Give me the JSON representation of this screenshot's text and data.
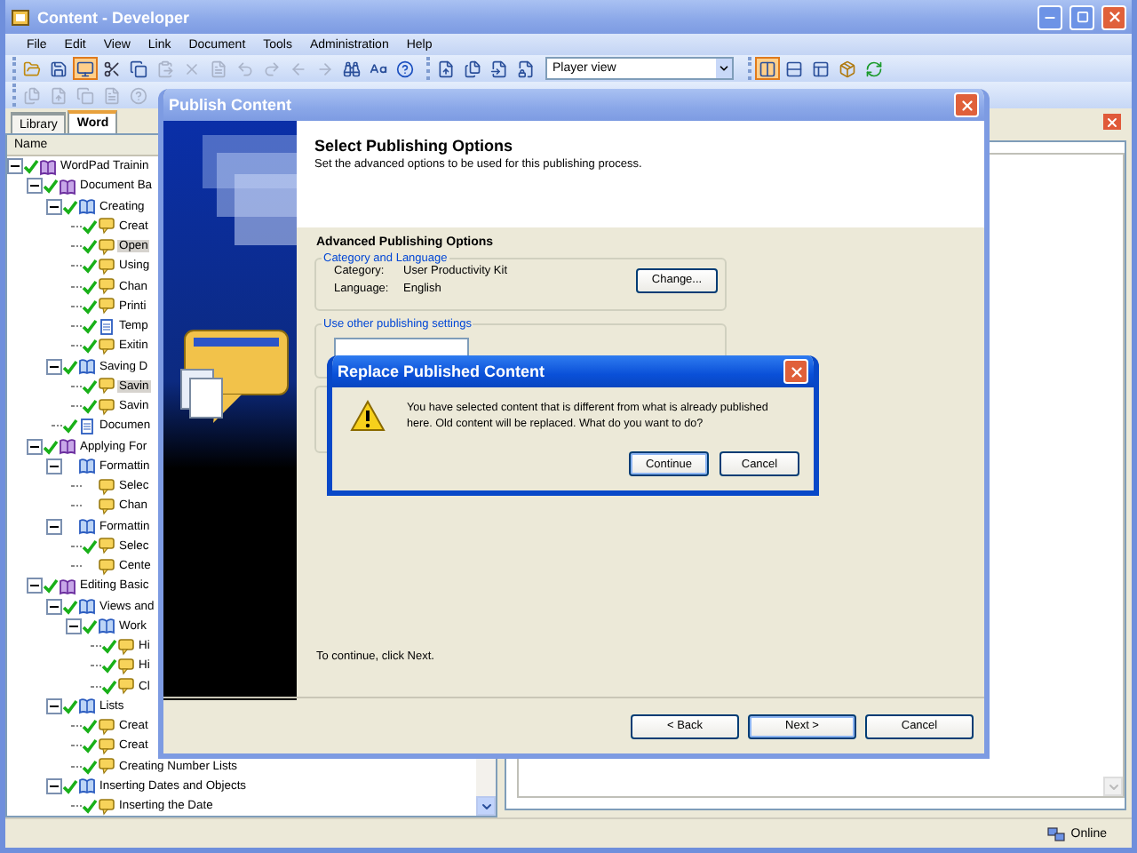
{
  "window": {
    "title": "Content - Developer",
    "active": false
  },
  "menu": [
    "File",
    "Edit",
    "View",
    "Link",
    "Document",
    "Tools",
    "Administration",
    "Help"
  ],
  "toolbar": {
    "groups": [
      {
        "items": [
          {
            "kind": "folder",
            "disabled": false,
            "selected": false
          },
          {
            "kind": "disk",
            "disabled": false,
            "selected": false
          },
          {
            "kind": "monitor",
            "disabled": false,
            "selected": true
          },
          {
            "kind": "scissors",
            "disabled": false,
            "selected": false
          },
          {
            "kind": "copy",
            "disabled": false,
            "selected": false
          },
          {
            "kind": "clipboard",
            "disabled": true,
            "selected": false
          },
          {
            "kind": "cross",
            "disabled": true,
            "selected": false
          },
          {
            "kind": "document",
            "disabled": true,
            "selected": false
          },
          {
            "kind": "undo",
            "disabled": true,
            "selected": false
          },
          {
            "kind": "redo",
            "disabled": true,
            "selected": false
          },
          {
            "kind": "arrowleft",
            "disabled": true,
            "selected": false
          },
          {
            "kind": "arrowright",
            "disabled": true,
            "selected": false
          },
          {
            "kind": "binoculars",
            "disabled": false,
            "selected": false
          },
          {
            "kind": "letters",
            "disabled": false,
            "selected": false
          },
          {
            "kind": "help",
            "disabled": false,
            "selected": false
          }
        ]
      },
      {
        "items": [
          {
            "kind": "upload",
            "disabled": false,
            "selected": false
          },
          {
            "kind": "files",
            "disabled": false,
            "selected": false
          },
          {
            "kind": "import",
            "disabled": false,
            "selected": false
          },
          {
            "kind": "lock",
            "disabled": false,
            "selected": false
          },
          {
            "kind": "select",
            "value": "Player view"
          }
        ]
      },
      {
        "items": [
          {
            "kind": "columns",
            "disabled": false,
            "selected": true
          },
          {
            "kind": "rows",
            "disabled": false,
            "selected": false
          },
          {
            "kind": "panels",
            "disabled": false,
            "selected": false
          },
          {
            "kind": "package",
            "disabled": false,
            "selected": false
          },
          {
            "kind": "refresh",
            "disabled": false,
            "selected": false
          }
        ]
      }
    ]
  },
  "toolbar_2": [
    {
      "kind": "files",
      "disabled": true
    },
    {
      "kind": "upload",
      "disabled": true
    },
    {
      "kind": "copy",
      "disabled": true
    },
    {
      "kind": "document",
      "disabled": true
    },
    {
      "kind": "help",
      "disabled": true
    }
  ],
  "tabs": [
    {
      "label": "Library",
      "selected": false
    },
    {
      "label": "Word",
      "selected": true
    }
  ],
  "tree": {
    "column": "Name",
    "items": [
      {
        "label": "WordPad Trainin",
        "kind": "module",
        "checked": true,
        "selected": false,
        "expanded": true,
        "children": [
          {
            "label": "Document Ba",
            "kind": "module",
            "checked": true,
            "selected": false,
            "expanded": true,
            "children": [
              {
                "label": "Creating",
                "kind": "section",
                "checked": true,
                "selected": false,
                "expanded": true,
                "children": [
                  {
                    "label": "Creat",
                    "kind": "topic",
                    "checked": true,
                    "selected": false
                  },
                  {
                    "label": "Open",
                    "kind": "topic",
                    "checked": true,
                    "selected": true
                  },
                  {
                    "label": "Using",
                    "kind": "topic",
                    "checked": true,
                    "selected": false
                  },
                  {
                    "label": "Chan",
                    "kind": "topic",
                    "checked": true,
                    "selected": false
                  },
                  {
                    "label": "Printi",
                    "kind": "topic",
                    "checked": true,
                    "selected": false
                  },
                  {
                    "label": "Temp",
                    "kind": "document",
                    "checked": true,
                    "selected": false
                  },
                  {
                    "label": "Exitin",
                    "kind": "topic",
                    "checked": true,
                    "selected": false
                  }
                ]
              },
              {
                "label": "Saving D",
                "kind": "section",
                "checked": true,
                "selected": false,
                "expanded": true,
                "children": [
                  {
                    "label": "Savin",
                    "kind": "topic",
                    "checked": true,
                    "selected": true
                  },
                  {
                    "label": "Savin",
                    "kind": "topic",
                    "checked": true,
                    "selected": false
                  }
                ]
              },
              {
                "label": "Documen",
                "kind": "document",
                "checked": true,
                "selected": false
              }
            ]
          },
          {
            "label": "Applying For",
            "kind": "module",
            "checked": true,
            "selected": false,
            "expanded": true,
            "children": [
              {
                "label": "Formattin",
                "kind": "section",
                "checked": false,
                "selected": false,
                "expanded": true,
                "children": [
                  {
                    "label": "Selec",
                    "kind": "topic",
                    "checked": false,
                    "selected": false
                  },
                  {
                    "label": "Chan",
                    "kind": "topic",
                    "checked": false,
                    "selected": false
                  }
                ]
              },
              {
                "label": "Formattin",
                "kind": "section",
                "checked": false,
                "selected": false,
                "expanded": true,
                "children": [
                  {
                    "label": "Selec",
                    "kind": "topic",
                    "checked": true,
                    "selected": false
                  },
                  {
                    "label": "Cente",
                    "kind": "topic",
                    "checked": false,
                    "selected": false
                  }
                ]
              }
            ]
          },
          {
            "label": "Editing Basic",
            "kind": "module",
            "checked": true,
            "selected": false,
            "expanded": true,
            "children": [
              {
                "label": "Views and",
                "kind": "section",
                "checked": true,
                "selected": false,
                "expanded": true,
                "children": [
                  {
                    "label": "Work",
                    "kind": "section",
                    "checked": true,
                    "selected": false,
                    "expanded": true,
                    "children": [
                      {
                        "label": "Hi",
                        "kind": "topic",
                        "checked": true,
                        "selected": false
                      },
                      {
                        "label": "Hi",
                        "kind": "topic",
                        "checked": true,
                        "selected": false
                      },
                      {
                        "label": "Cl",
                        "kind": "topic",
                        "checked": true,
                        "selected": false
                      }
                    ]
                  }
                ]
              },
              {
                "label": "Lists",
                "kind": "section",
                "checked": true,
                "selected": false,
                "expanded": true,
                "children": [
                  {
                    "label": "Creat",
                    "kind": "topic",
                    "checked": true,
                    "selected": false
                  },
                  {
                    "label": "Creat",
                    "kind": "topic",
                    "checked": true,
                    "selected": false
                  },
                  {
                    "label": "Creating Number Lists",
                    "kind": "topic",
                    "checked": true,
                    "selected": false
                  }
                ]
              },
              {
                "label": "Inserting Dates and Objects",
                "kind": "section",
                "checked": true,
                "selected": false,
                "expanded": true,
                "children": [
                  {
                    "label": "Inserting the Date",
                    "kind": "topic",
                    "checked": true,
                    "selected": false
                  }
                ]
              }
            ]
          }
        ]
      }
    ]
  },
  "publish_dialog": {
    "title": "Publish Content",
    "active": false,
    "heading": "Select Publishing Options",
    "subheading": "Set the advanced options to be used for this publishing process.",
    "section": "Advanced Publishing Options",
    "groups": [
      {
        "kind": "fields",
        "label": "Category and Language",
        "fields": [
          {
            "name": "Category:",
            "value": "User Productivity Kit"
          },
          {
            "name": "Language:",
            "value": "English"
          }
        ],
        "button": "Change..."
      },
      {
        "kind": "dropdown",
        "label": "Use other publishing settings"
      },
      {
        "kind": "empty"
      }
    ],
    "hint": "To continue, click Next.",
    "buttons": [
      {
        "label": "< Back",
        "default": false
      },
      {
        "label": "Next >",
        "default": true
      },
      {
        "label": "Cancel",
        "default": false
      }
    ]
  },
  "replace_dialog": {
    "title": "Replace Published Content",
    "active": true,
    "message": "You have selected content that is different from what is already published here. Old content will be replaced. What do you want to do?",
    "buttons": [
      {
        "label": "Continue",
        "default": true
      },
      {
        "label": "Cancel",
        "default": false
      }
    ]
  },
  "status_bar": {
    "text": "Online"
  }
}
